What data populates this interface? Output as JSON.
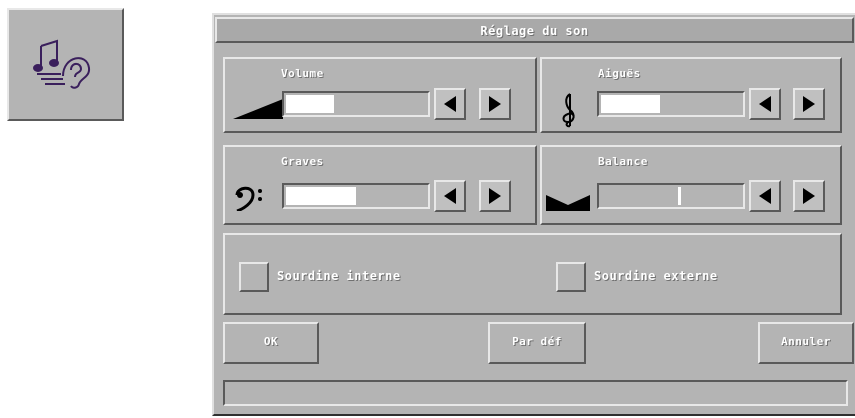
{
  "app_icon": {
    "icon": "music-ear-icon"
  },
  "dialog": {
    "title": "Réglage du son",
    "controls": [
      {
        "id": "volume",
        "label": "Volume",
        "icon": "volume-ramp-icon",
        "level": 0.34
      },
      {
        "id": "aigus",
        "label": "Aiguës",
        "icon": "treble-clef-icon",
        "level": 0.42
      },
      {
        "id": "graves",
        "label": "Graves",
        "icon": "bass-clef-icon",
        "level": 0.5
      },
      {
        "id": "balance",
        "label": "Balance",
        "icon": "balance-notch-icon",
        "level": 0.5
      }
    ],
    "mute_internal": {
      "label": "Sourdine interne",
      "checked": false
    },
    "mute_external": {
      "label": "Sourdine externe",
      "checked": false
    },
    "buttons": {
      "ok": "OK",
      "default": "Par déf",
      "cancel": "Annuler"
    },
    "status": ""
  }
}
